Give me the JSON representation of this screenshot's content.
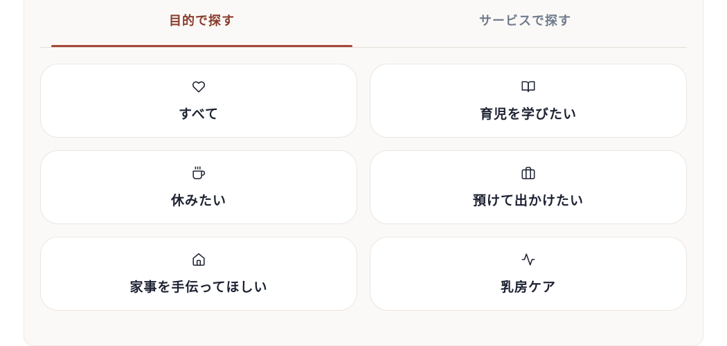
{
  "tabs": [
    {
      "label": "目的で探す",
      "active": true
    },
    {
      "label": "サービスで探す",
      "active": false
    }
  ],
  "colors": {
    "accent": "#a5483a",
    "active_tab_text": "#8a3b2c",
    "inactive_tab_text": "#6f7c8e",
    "card_text": "#1d2232",
    "panel_bg": "#fbf9f7"
  },
  "cards": [
    {
      "label": "すべて",
      "icon": "heart-icon"
    },
    {
      "label": "育児を学びたい",
      "icon": "book-open-icon"
    },
    {
      "label": "休みたい",
      "icon": "coffee-cup-icon"
    },
    {
      "label": "預けて出かけたい",
      "icon": "briefcase-icon"
    },
    {
      "label": "家事を手伝ってほしい",
      "icon": "home-icon"
    },
    {
      "label": "乳房ケア",
      "icon": "activity-pulse-icon"
    }
  ]
}
